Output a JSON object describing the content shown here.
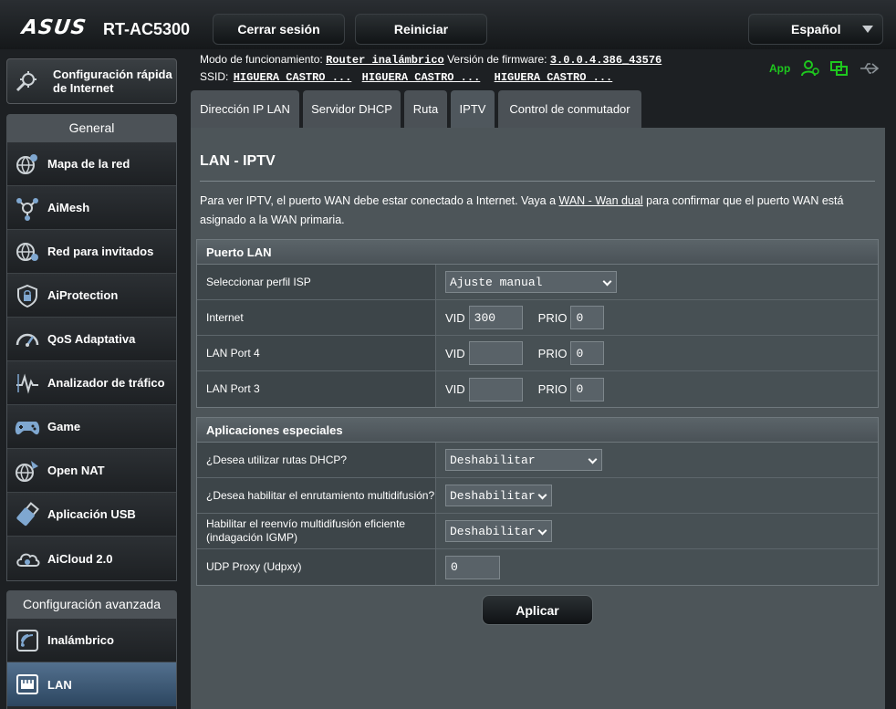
{
  "header": {
    "brand": "ASUS",
    "model": "RT-AC5300",
    "logout_label": "Cerrar sesión",
    "reboot_label": "Reiniciar",
    "language": "Español"
  },
  "status": {
    "mode_label": "Modo de funcionamiento:",
    "mode_value": "Router inalámbrico",
    "firmware_label": "Versión de firmware:",
    "firmware_value": "3.0.0.4.386_43576",
    "ssid_label": "SSID:",
    "ssids": [
      "HIGUERA CASTRO ...",
      "HIGUERA CASTRO ...",
      "HIGUERA CASTRO ..."
    ],
    "app_label": "App"
  },
  "sidebar": {
    "quick_setup": "Configuración rápida de Internet",
    "general_title": "General",
    "general_items": [
      {
        "label": "Mapa de la red"
      },
      {
        "label": "AiMesh"
      },
      {
        "label": "Red para invitados"
      },
      {
        "label": "AiProtection"
      },
      {
        "label": "QoS Adaptativa"
      },
      {
        "label": "Analizador de tráfico"
      },
      {
        "label": "Game"
      },
      {
        "label": "Open NAT"
      },
      {
        "label": "Aplicación USB"
      },
      {
        "label": "AiCloud 2.0"
      }
    ],
    "advanced_title": "Configuración avanzada",
    "advanced_items": [
      {
        "label": "Inalámbrico"
      },
      {
        "label": "LAN"
      }
    ]
  },
  "tabs": [
    "Dirección IP LAN",
    "Servidor DHCP",
    "Ruta",
    "IPTV",
    "Control de conmutador"
  ],
  "page": {
    "title": "LAN - IPTV",
    "desc_part1": "Para ver IPTV, el puerto WAN debe estar conectado a Internet. Vaya a ",
    "desc_link": "WAN - Wan dual",
    "desc_part2": " para confirmar que el puerto WAN está asignado a la WAN primaria.",
    "apply_label": "Aplicar"
  },
  "lan_port": {
    "header": "Puerto LAN",
    "isp_label": "Seleccionar perfil ISP",
    "isp_value": "Ajuste manual",
    "vid_label": "VID",
    "prio_label": "PRIO",
    "rows": [
      {
        "label": "Internet",
        "vid": "300",
        "prio": "0"
      },
      {
        "label": "LAN Port 4",
        "vid": "",
        "prio": "0"
      },
      {
        "label": "LAN Port 3",
        "vid": "",
        "prio": "0"
      }
    ]
  },
  "special_apps": {
    "header": "Aplicaciones especiales",
    "rows": [
      {
        "label": "¿Desea utilizar rutas DHCP?",
        "value": "Deshabilitar"
      },
      {
        "label": "¿Desea habilitar el enrutamiento multidifusión?",
        "value": "Deshabilitar"
      },
      {
        "label": "Habilitar el reenvío multidifusión eficiente (indagación IGMP)",
        "value": "Deshabilitar"
      }
    ],
    "udp_label": "UDP Proxy (Udpxy)",
    "udp_value": "0"
  }
}
